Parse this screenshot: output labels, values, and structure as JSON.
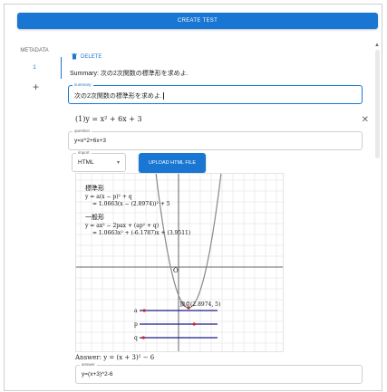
{
  "header": {
    "create_label": "CREATE TEST"
  },
  "rail": {
    "metadata_label": "METADATA",
    "item_one": "1",
    "plus": "+"
  },
  "main": {
    "delete_label": "DELETE",
    "summary_text": "Summary: 次の2次関数の標準形を求めよ.",
    "summary_field": {
      "label": "summary",
      "value": "次の2次関数の標準形を求めよ."
    },
    "item_title": "(1)y = x² + 6x + 3",
    "question_field": {
      "label": "question",
      "value": "y=x^2+6x+3"
    },
    "format_select": {
      "label": "import",
      "value": "HTML"
    },
    "upload_label": "UPLOAD HTML FILE",
    "answer_text": "Answer: y = (x + 3)² − 6",
    "answer_field": {
      "label": "answer",
      "value": "y=(x+3)^2-6"
    }
  },
  "plot": {
    "std_title": "標準形",
    "std_eq1": "y = a(x − p)² + q",
    "std_eq2": "= 1.0663(x − (2.8974))² + 5",
    "gen_title": "一般形",
    "gen_eq1": "y = ax² − 2pax + (ap² + q)",
    "gen_eq2": "= 1.0663x² + (-6.1787)x + (3.9511)",
    "origin": "O",
    "vertex_label": "頂点(2.8974, 5)",
    "slider_a": "a",
    "slider_p": "p",
    "slider_q": "q",
    "slider_a_value": 0.06,
    "slider_p_value": 0.7,
    "slider_q_value": 0.05
  },
  "colors": {
    "accent": "#1976d2",
    "slider_line": "#1a1a8a",
    "point": "#c62828"
  }
}
